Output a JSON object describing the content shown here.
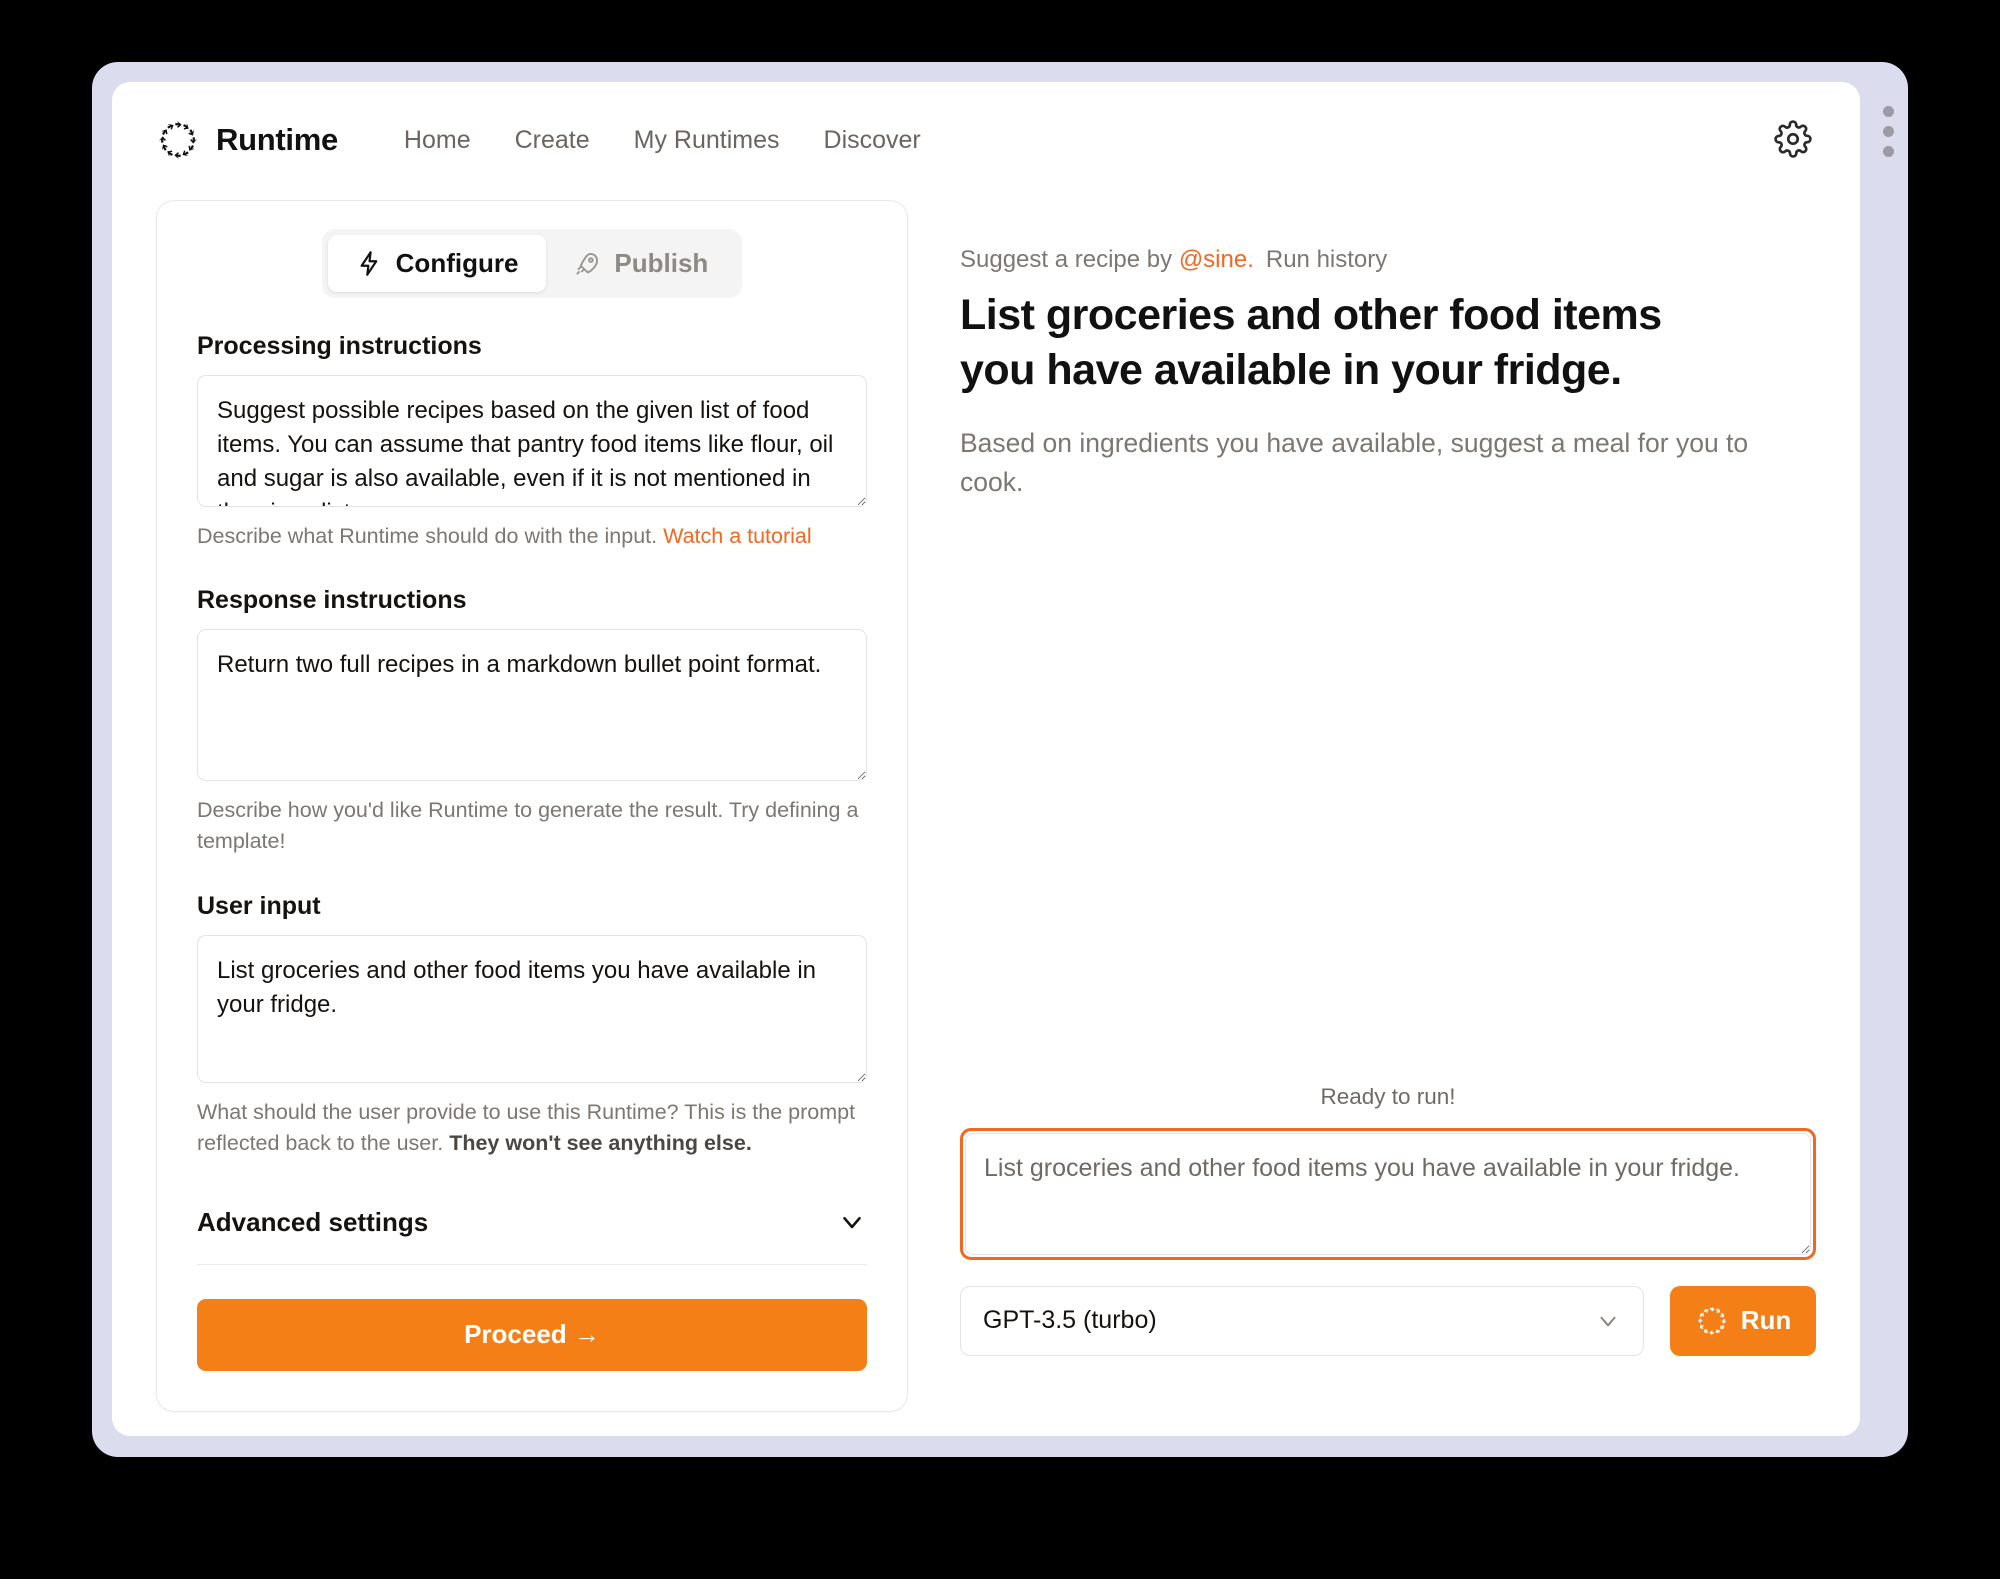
{
  "header": {
    "brand_name": "Runtime",
    "logo_icon": "runtime-ring-icon",
    "nav": [
      {
        "label": "Home"
      },
      {
        "label": "Create"
      },
      {
        "label": "My Runtimes"
      },
      {
        "label": "Discover"
      }
    ],
    "settings_icon": "gear-icon"
  },
  "config": {
    "tabs": [
      {
        "label": "Configure",
        "icon": "lightning-bolt-icon",
        "active": true
      },
      {
        "label": "Publish",
        "icon": "rocket-icon",
        "active": false
      }
    ],
    "processing": {
      "label": "Processing instructions",
      "value": "Suggest possible recipes based on the given list of food items. You can assume that pantry food items like flour, oil and sugar is also available, even if it is not mentioned in the given list.",
      "help_prefix": "Describe what Runtime should do with the input. ",
      "help_link": "Watch a tutorial"
    },
    "response": {
      "label": "Response instructions",
      "value": "Return two full recipes in a markdown bullet point format.",
      "help": "Describe how you'd like Runtime to generate the result. Try defining a template!"
    },
    "user_input": {
      "label": "User input",
      "value": "List groceries and other food items you have available in your fridge.",
      "help_prefix": "What should the user provide to use this Runtime? This is the prompt reflected back to the user. ",
      "help_bold": "They won't see anything else."
    },
    "advanced": {
      "label": "Advanced settings",
      "chevron_icon": "chevron-down-icon"
    },
    "proceed_label": "Proceed →"
  },
  "preview": {
    "byline_prefix": "Suggest a recipe by ",
    "byline_handle": "@sine.",
    "run_history_label": "Run history",
    "title": "List groceries and other food items you have available in your fridge.",
    "description": "Based on ingredients you have available, suggest a meal for you to cook."
  },
  "run": {
    "status": "Ready to run!",
    "input_value": "",
    "input_placeholder": "List groceries and other food items you have available in your fridge.",
    "model": "GPT-3.5 (turbo)",
    "model_chevron_icon": "chevron-down-icon",
    "run_label": "Run",
    "run_icon": "runtime-ring-icon"
  },
  "colors": {
    "accent": "#f57f17",
    "link": "#f26722",
    "frame": "#dcdcef"
  }
}
